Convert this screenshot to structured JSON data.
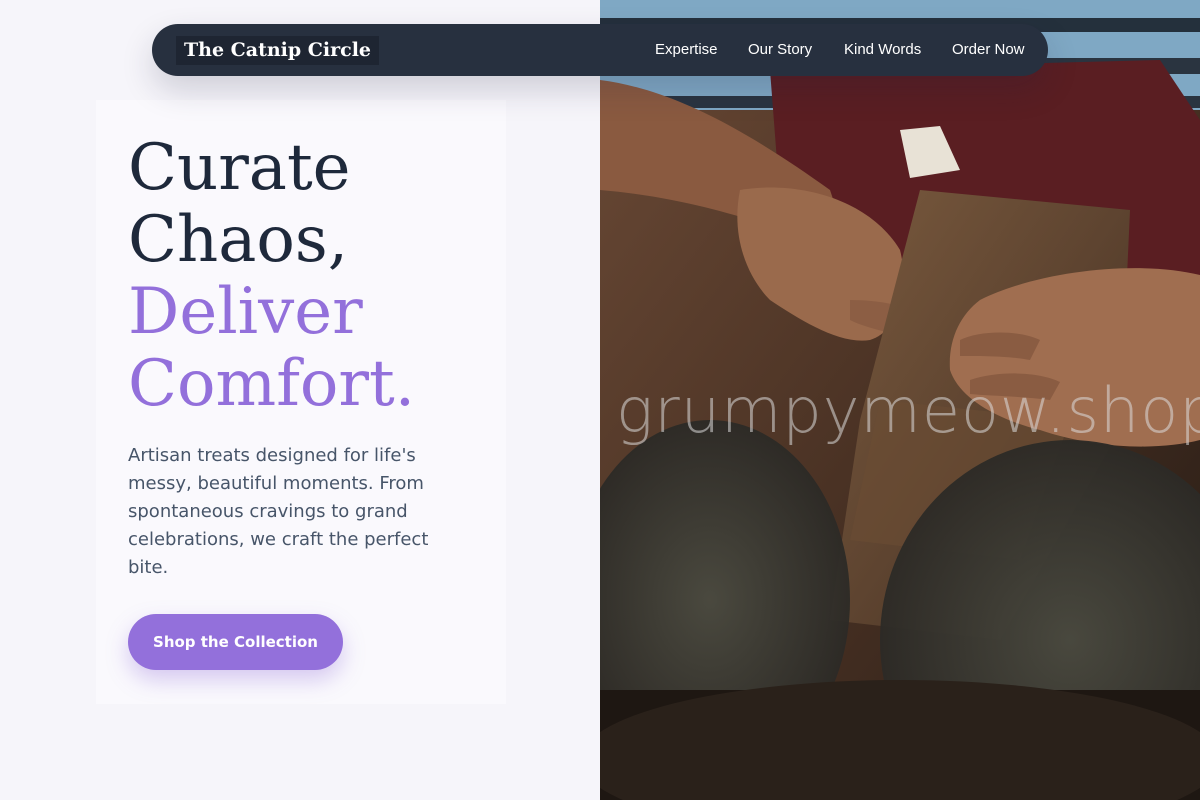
{
  "brand": {
    "name": "The Catnip Circle"
  },
  "nav": {
    "links": [
      "Expertise",
      "Our Story",
      "Kind Words",
      "Order Now"
    ]
  },
  "hero": {
    "headline_line1": "Curate",
    "headline_line2": "Chaos,",
    "headline_line3": "Deliver",
    "headline_line4": "Comfort.",
    "subtext": "Artisan treats designed for life's messy, beautiful moments. From spontaneous cravings to grand celebrations, we craft the perfect bite.",
    "cta_label": "Shop the Collection"
  },
  "photo": {
    "watermark": "grumpymeow.shop"
  },
  "colors": {
    "accent": "#9370db",
    "navbar": "#27303f",
    "heading": "#1e293b",
    "body_text": "#475569"
  }
}
